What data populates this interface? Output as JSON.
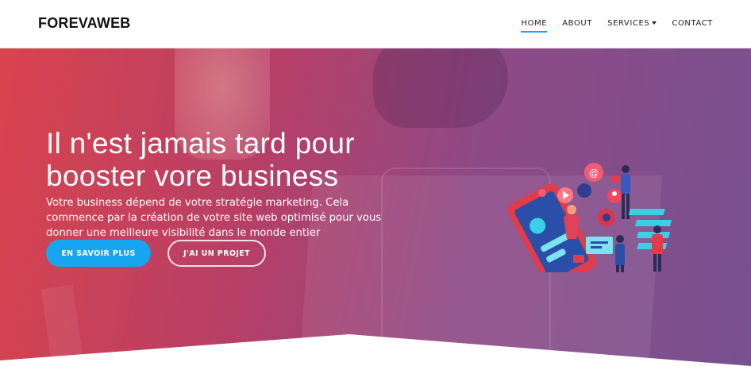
{
  "brand": "FOREVAWEB",
  "nav": [
    {
      "label": "HOME",
      "active": true
    },
    {
      "label": "ABOUT"
    },
    {
      "label": "SERVICES",
      "dropdown": true
    },
    {
      "label": "CONTACT"
    }
  ],
  "hero": {
    "title_line1": "Il n'est jamais tard pour",
    "title_line2": "booster vore business",
    "text": "Votre business dépend de votre stratégie marketing. Cela commence par la création de votre site web optimisé pour vous donner une meilleure visibilité dans le monde entier",
    "primary_button": "EN SAVOIR PLUS",
    "secondary_button": "J'AI UN PROJET",
    "illustration_icon": "digital-marketing-illustration"
  },
  "colors": {
    "accent": "#16a9f2",
    "hero_start": "#d9434d",
    "hero_end": "#78518f"
  }
}
